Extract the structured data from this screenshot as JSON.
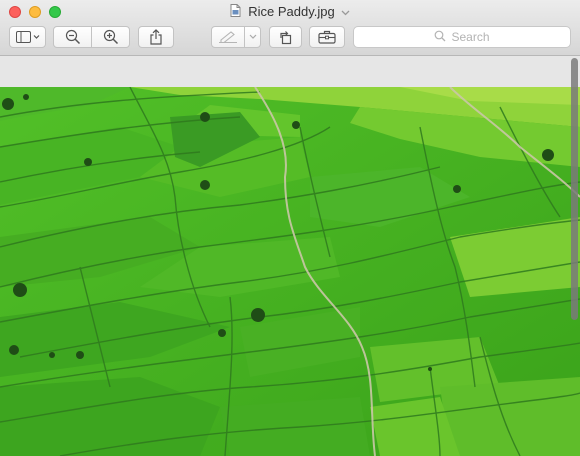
{
  "window": {
    "title": "Rice Paddy.jpg",
    "traffic_lights": {
      "close_color": "#fc605c",
      "minimize_color": "#fdbc40",
      "zoom_color": "#34c84a"
    }
  },
  "toolbar": {
    "sidebar_button_icon": "sidebar-icon",
    "zoom_out_icon": "zoom-out-icon",
    "zoom_in_icon": "zoom-in-icon",
    "share_icon": "share-icon",
    "markup_icon": "markup-pen-icon",
    "rotate_icon": "rotate-icon",
    "toolbox_icon": "toolbox-icon"
  },
  "search": {
    "placeholder": "Search"
  },
  "image": {
    "subject": "aerial view of green rice paddies",
    "accent": "#5cc82a"
  }
}
